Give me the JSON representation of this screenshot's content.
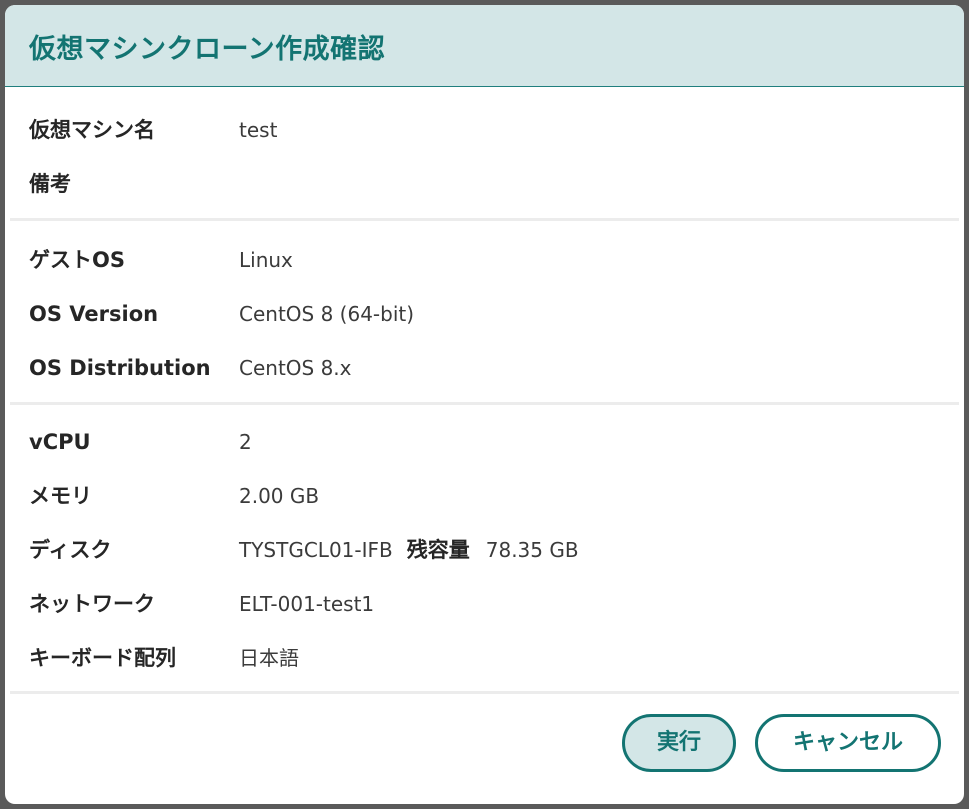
{
  "dialog": {
    "title": "仮想マシンクローン作成確認"
  },
  "section_basic": {
    "vm_name_label": "仮想マシン名",
    "vm_name_value": "test",
    "note_label": "備考",
    "note_value": ""
  },
  "section_os": {
    "guest_os_label": "ゲストOS",
    "guest_os_value": "Linux",
    "os_version_label": "OS Version",
    "os_version_value": "CentOS 8 (64-bit)",
    "os_distribution_label": "OS Distribution",
    "os_distribution_value": "CentOS 8.x"
  },
  "section_resources": {
    "vcpu_label": "vCPU",
    "vcpu_value": "2",
    "memory_label": "メモリ",
    "memory_value": "2.00 GB",
    "disk_label": "ディスク",
    "disk_value": "TYSTGCL01-IFB",
    "disk_free_label": "残容量",
    "disk_free_value": "78.35 GB",
    "network_label": "ネットワーク",
    "network_value": "ELT-001-test1",
    "keyboard_label": "キーボード配列",
    "keyboard_value": "日本語"
  },
  "footer": {
    "execute_label": "実行",
    "cancel_label": "キャンセル"
  },
  "colors": {
    "accent": "#137472",
    "header_bg": "#d3e6e7"
  }
}
